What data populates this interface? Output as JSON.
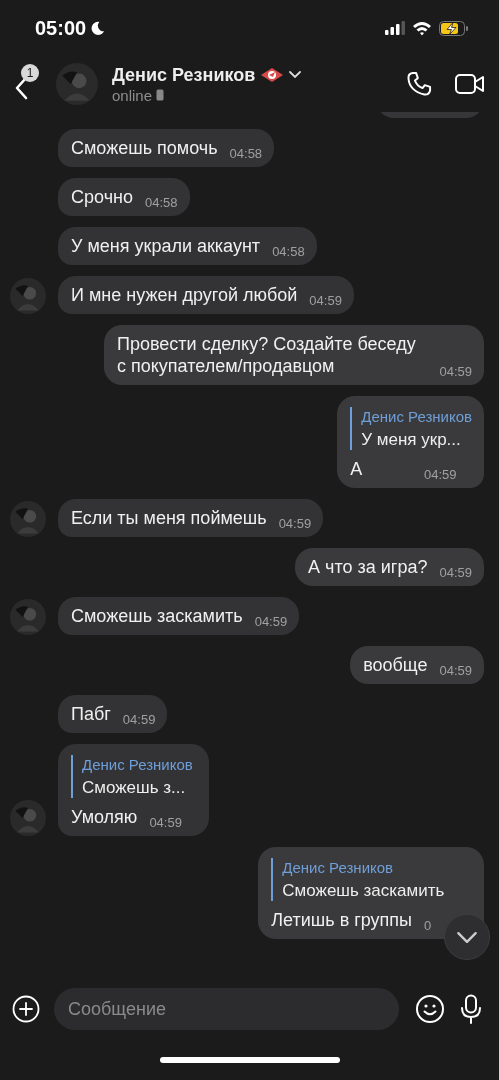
{
  "status_bar": {
    "time": "05:00"
  },
  "header": {
    "back_badge": "1",
    "name": "Денис Резников",
    "status": "online"
  },
  "messages": [
    {
      "kind": "partial",
      "outgoing": true
    },
    {
      "kind": "text",
      "outgoing": false,
      "avatar": false,
      "text": "Сможешь помочь",
      "time": "04:58"
    },
    {
      "kind": "text",
      "outgoing": false,
      "avatar": false,
      "text": "Срочно",
      "time": "04:58"
    },
    {
      "kind": "text",
      "outgoing": false,
      "avatar": false,
      "text": "У меня украли аккаунт",
      "time": "04:58"
    },
    {
      "kind": "text",
      "outgoing": false,
      "avatar": true,
      "text": "И мне нужен другой любой",
      "time": "04:59"
    },
    {
      "kind": "text",
      "outgoing": true,
      "text": "Провести сделку? Создайте беседу с покупателем/продавцом",
      "time": "04:59"
    },
    {
      "kind": "reply",
      "outgoing": true,
      "quote_name": "Денис Резников",
      "quote_text": "У меня укр...",
      "text": "А",
      "time": "04:59"
    },
    {
      "kind": "text",
      "outgoing": false,
      "avatar": true,
      "text": "Если ты меня поймешь",
      "time": "04:59"
    },
    {
      "kind": "text",
      "outgoing": true,
      "text": "А что за игра?",
      "time": "04:59"
    },
    {
      "kind": "text",
      "outgoing": false,
      "avatar": true,
      "text": "Сможешь заскамить",
      "time": "04:59"
    },
    {
      "kind": "text",
      "outgoing": true,
      "text": "вообще",
      "time": "04:59"
    },
    {
      "kind": "text",
      "outgoing": false,
      "avatar": false,
      "text": "Пабг",
      "time": "04:59"
    },
    {
      "kind": "reply",
      "outgoing": false,
      "avatar": true,
      "quote_name": "Денис Резников",
      "quote_text": "Сможешь з...",
      "text": "Умоляю",
      "time": "04:59"
    },
    {
      "kind": "reply",
      "outgoing": true,
      "quote_name": "Денис Резников",
      "quote_text": "Сможешь заскамить",
      "text": "Летишь в группы",
      "time": "0"
    }
  ],
  "composer": {
    "placeholder": "Сообщение"
  }
}
